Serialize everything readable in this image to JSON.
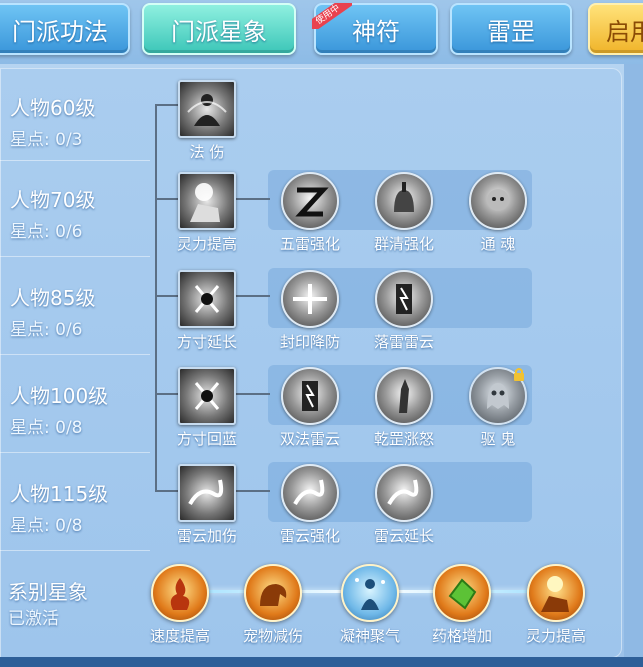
{
  "tabs": [
    {
      "label": "门派功法",
      "style": "blue"
    },
    {
      "label": "门派星象",
      "style": "active"
    },
    {
      "label": "神符",
      "style": "blue",
      "badge": "使用中"
    },
    {
      "label": "雷罡",
      "style": "blue"
    },
    {
      "label": "启用",
      "style": "gold"
    }
  ],
  "levels": [
    {
      "title": "人物60级",
      "stars": "星点: 0/3"
    },
    {
      "title": "人物70级",
      "stars": "星点: 0/6"
    },
    {
      "title": "人物85级",
      "stars": "星点: 0/6"
    },
    {
      "title": "人物100级",
      "stars": "星点: 0/8"
    },
    {
      "title": "人物115级",
      "stars": "星点: 0/8"
    }
  ],
  "skills": {
    "row1": [
      "法 伤"
    ],
    "row2": [
      "灵力提高",
      "五雷强化",
      "群清强化",
      "通 魂"
    ],
    "row3": [
      "方寸延长",
      "封印降防",
      "落雷雷云"
    ],
    "row4": [
      "方寸回蓝",
      "双法雷云",
      "乾罡涨怒",
      "驱 鬼"
    ],
    "row5": [
      "雷云加伤",
      "雷云强化",
      "雷云延长"
    ]
  },
  "system": {
    "title": "系别星象",
    "status": "已激活",
    "skills": [
      "速度提高",
      "宠物减伤",
      "凝神聚气",
      "药格增加",
      "灵力提高"
    ]
  },
  "colors": {
    "accent": "#3cc6b8",
    "tab_blue": "#3a96da",
    "gold": "#f0b42a"
  },
  "icons": {
    "lock": "lock-icon"
  }
}
